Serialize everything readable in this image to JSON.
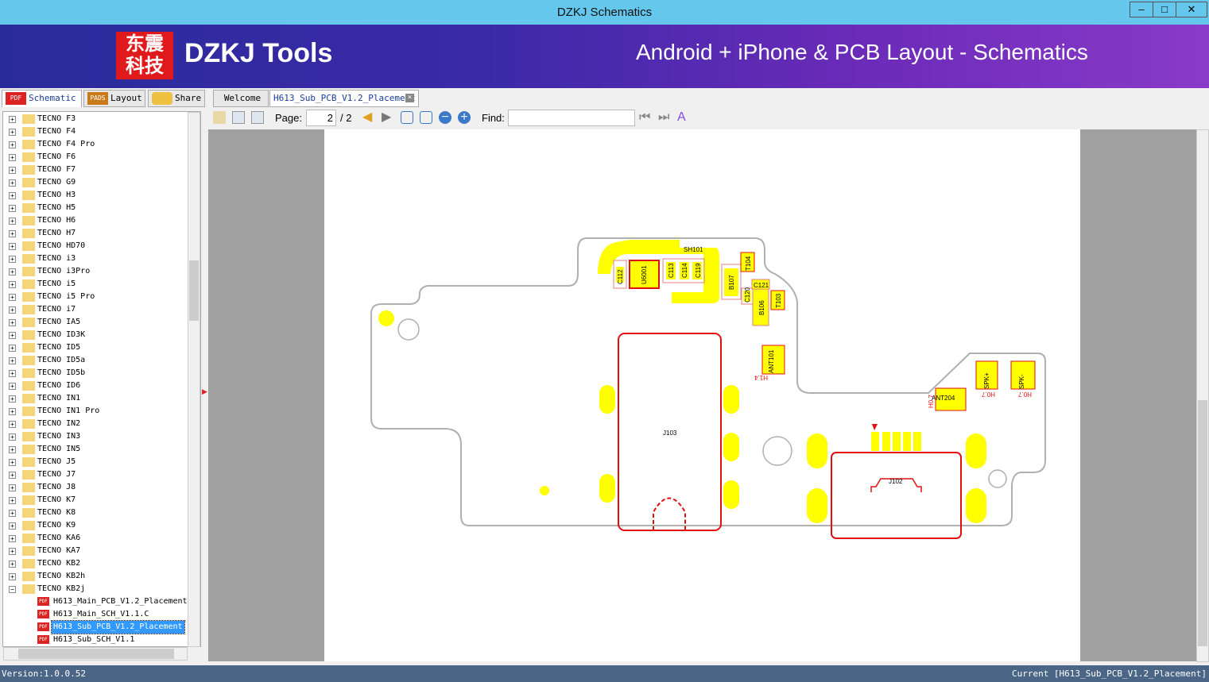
{
  "window": {
    "title": "DZKJ Schematics",
    "minimize": "–",
    "maximize": "□",
    "close": "✕"
  },
  "banner": {
    "logo": "东震\n科技",
    "brand": "DZKJ Tools",
    "tagline": "Android + iPhone & PCB Layout - Schematics"
  },
  "left_tabs": [
    {
      "label": "Schematic",
      "icon": "PDF"
    },
    {
      "label": "Layout",
      "icon": "PADS"
    },
    {
      "label": "Share",
      "icon": "cloud-add"
    }
  ],
  "doc_tabs": [
    {
      "label": "Welcome"
    },
    {
      "label": "H613_Sub_PCB_V1.2_Placement",
      "active": true
    }
  ],
  "toolbar": {
    "page_label": "Page:",
    "page_value": "2",
    "page_total": "/ 2",
    "find_label": "Find:",
    "find_value": ""
  },
  "tree": {
    "folders": [
      "TECNO F3",
      "TECNO F4",
      "TECNO F4 Pro",
      "TECNO F6",
      "TECNO F7",
      "TECNO G9",
      "TECNO H3",
      "TECNO H5",
      "TECNO H6",
      "TECNO H7",
      "TECNO HD70",
      "TECNO i3",
      "TECNO i3Pro",
      "TECNO i5",
      "TECNO i5 Pro",
      "TECNO i7",
      "TECNO IA5",
      "TECNO ID3K",
      "TECNO ID5",
      "TECNO ID5a",
      "TECNO ID5b",
      "TECNO ID6",
      "TECNO IN1",
      "TECNO IN1 Pro",
      "TECNO IN2",
      "TECNO IN3",
      "TECNO IN5",
      "TECNO J5",
      "TECNO J7",
      "TECNO J8",
      "TECNO K7",
      "TECNO K8",
      "TECNO K9",
      "TECNO KA6",
      "TECNO KA7",
      "TECNO KB2",
      "TECNO KB2h",
      "TECNO KB2j"
    ],
    "expanded": "TECNO KB2j",
    "files": [
      {
        "label": "H613_Main_PCB_V1.2_Placement"
      },
      {
        "label": "H613_Main_SCH_V1.1.C"
      },
      {
        "label": "H613_Sub_PCB_V1.2_Placement",
        "selected": true
      },
      {
        "label": "H613_Sub_SCH_V1.1"
      }
    ]
  },
  "pcb": {
    "labels": {
      "sh101": "SH101",
      "c112": "C112",
      "u6001": "U6001",
      "c113": "C113",
      "c114": "C114",
      "c119": "C119",
      "b107": "B107",
      "t104": "T104",
      "c121": "C121",
      "c120": "C120",
      "b106": "B106",
      "t103": "T103",
      "ant101": "ANT101",
      "h14": "H1.4",
      "ant204": "ANT204",
      "h07a": "H0.7",
      "spkp": "SPK+",
      "h07b": "H0.7",
      "spkm": "SPK-",
      "h07c": "H0.7",
      "j103": "J103",
      "j102": "J102"
    },
    "colors": {
      "outline": "#b0b0b0",
      "pad": "#ffff00",
      "silk": "#e01010"
    }
  },
  "status": {
    "version": "Version:1.0.0.52",
    "current": "Current [H613_Sub_PCB_V1.2_Placement]"
  }
}
